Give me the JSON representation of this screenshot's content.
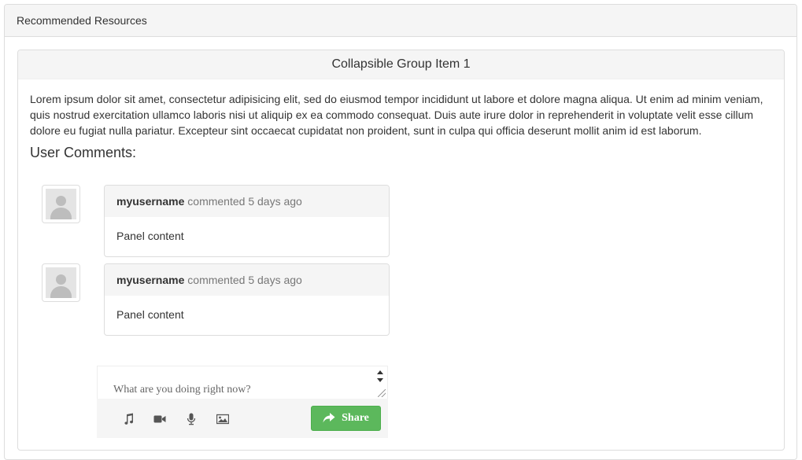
{
  "outer": {
    "title": "Recommended Resources"
  },
  "group": {
    "title": "Collapsible Group Item 1",
    "lorem": "Lorem ipsum dolor sit amet, consectetur adipisicing elit, sed do eiusmod tempor incididunt ut labore et dolore magna aliqua. Ut enim ad minim veniam, quis nostrud exercitation ullamco laboris nisi ut aliquip ex ea commodo consequat. Duis aute irure dolor in reprehenderit in voluptate velit esse cillum dolore eu fugiat nulla pariatur. Excepteur sint occaecat cupidatat non proident, sunt in culpa qui officia deserunt mollit anim id est laborum.",
    "comments_title": "User Comments:"
  },
  "comments": [
    {
      "username": "myusername",
      "meta": "commented 5 days ago",
      "body": "Panel content"
    },
    {
      "username": "myusername",
      "meta": "commented 5 days ago",
      "body": "Panel content"
    }
  ],
  "composer": {
    "placeholder": "What are you doing right now?",
    "share_label": "Share",
    "icons": [
      "music-icon",
      "video-camera-icon",
      "microphone-icon",
      "image-icon"
    ]
  },
  "colors": {
    "share_green": "#5cb85c",
    "heading_bg": "#f5f5f5",
    "border": "#dddddd"
  }
}
